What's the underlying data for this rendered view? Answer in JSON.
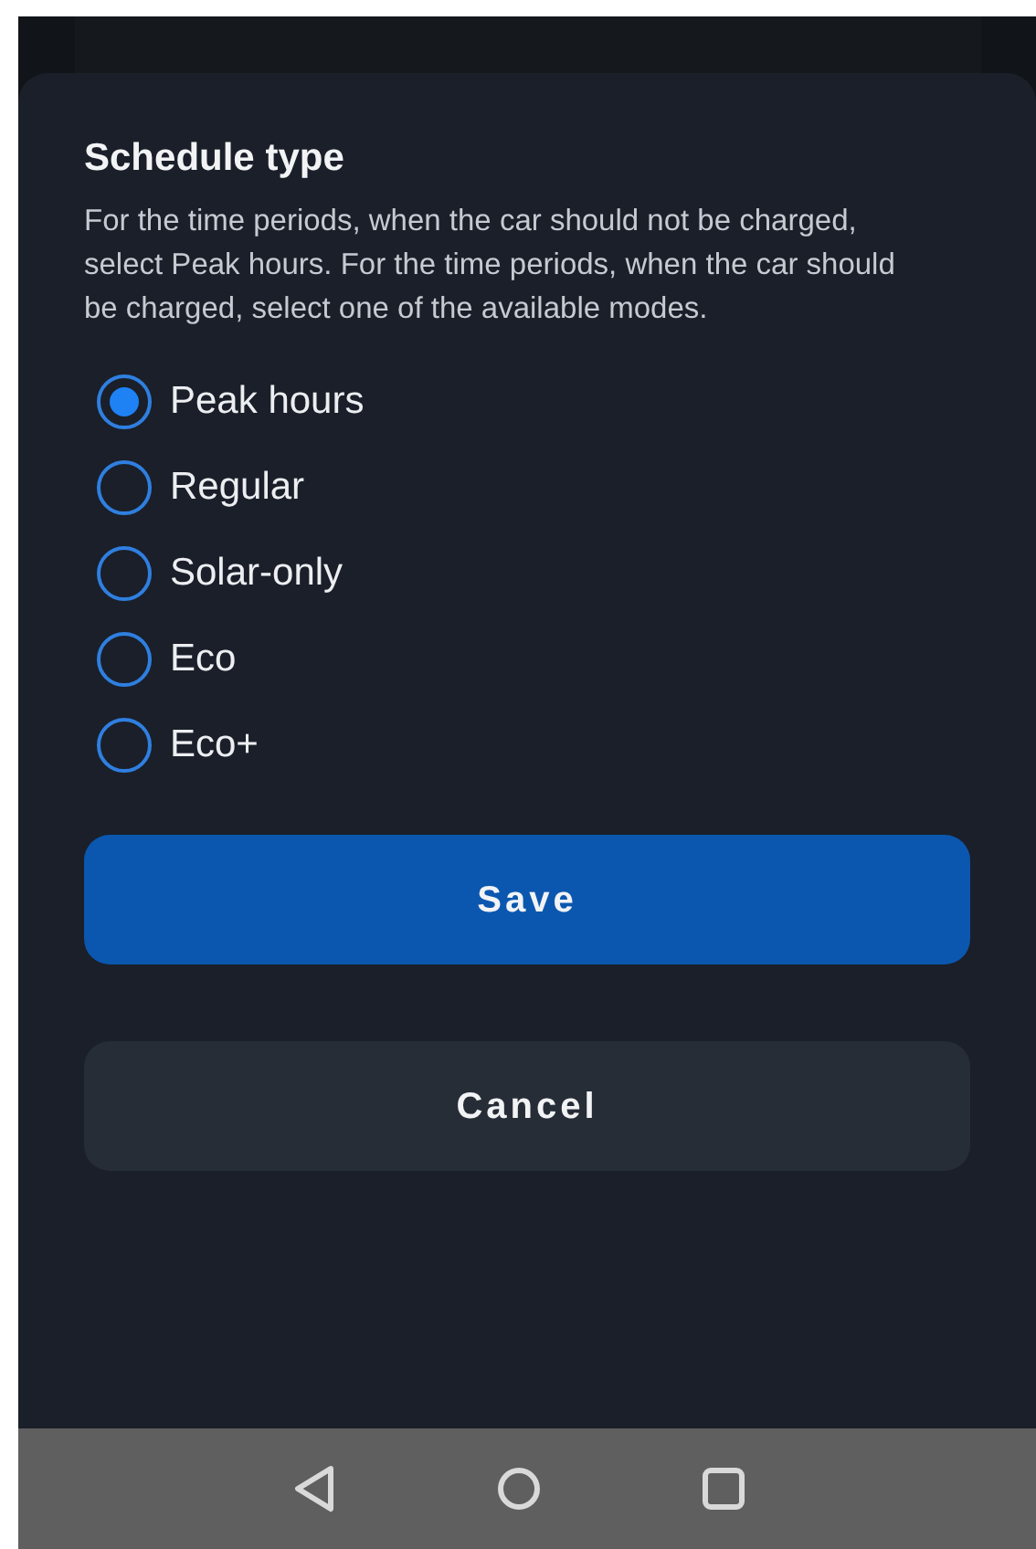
{
  "sheet": {
    "title": "Schedule type",
    "description": "For the time periods, when the car should not be charged, select Peak hours. For the time periods, when the car should be charged, select one of the available modes.",
    "options": [
      {
        "label": "Peak hours",
        "selected": true
      },
      {
        "label": "Regular",
        "selected": false
      },
      {
        "label": "Solar-only",
        "selected": false
      },
      {
        "label": "Eco",
        "selected": false
      },
      {
        "label": "Eco+",
        "selected": false
      }
    ],
    "buttons": [
      {
        "label": "Save",
        "kind": "primary"
      },
      {
        "label": "Cancel",
        "kind": "secondary"
      }
    ]
  }
}
